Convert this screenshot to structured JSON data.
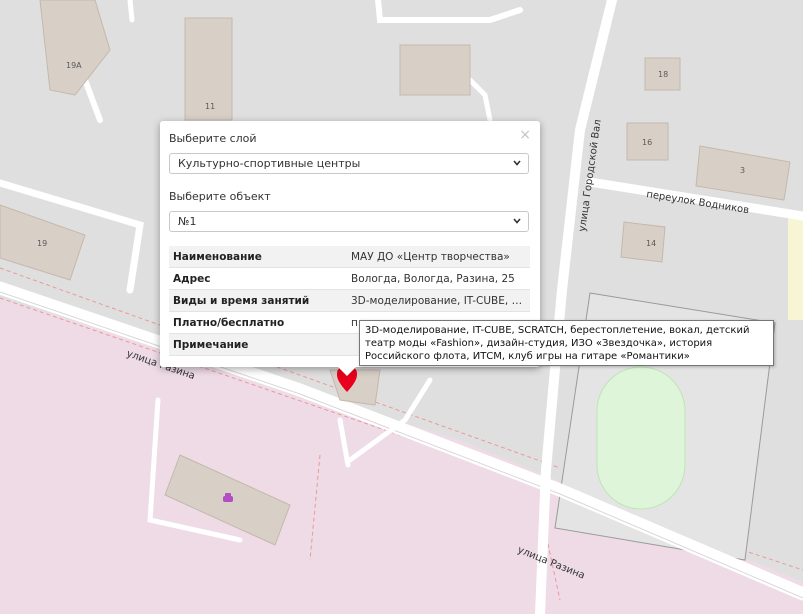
{
  "map": {
    "buildings": [
      "19А",
      "11",
      "18",
      "16",
      "3",
      "14",
      "19"
    ],
    "streets": [
      "улица Городской Вал",
      "переулок Водников",
      "улица Разина",
      "улица Разина"
    ],
    "marker_color": "#e8001c",
    "park_color": "#dff5d9",
    "zone_color": "#eedbe6"
  },
  "popup": {
    "close_glyph": "×",
    "layer_caption": "Выберите слой",
    "layer_value": "Культурно-спортивные центры",
    "object_caption": "Выберите объект",
    "object_value": "№1",
    "rows": [
      {
        "key": "Наименование",
        "value": "МАУ ДО «Центр творчества»"
      },
      {
        "key": "Адрес",
        "value": "Вологда, Вологда, Разина, 25"
      },
      {
        "key": "Виды и время занятий",
        "value": "3D-моделирование, IT-CUBE, SC..."
      },
      {
        "key": "Платно/бесплатно",
        "value": "п..."
      },
      {
        "key": "Примечание",
        "value": ""
      }
    ]
  },
  "tooltip": {
    "text": "3D-моделирование, IT-CUBE, SCRATCH, берестоплетение, вокал, детский театр моды «Fashion», дизайн-студия, ИЗО «Звездочка», история Российского флота, ИТСМ, клуб игры на гитаре «Романтики»"
  }
}
